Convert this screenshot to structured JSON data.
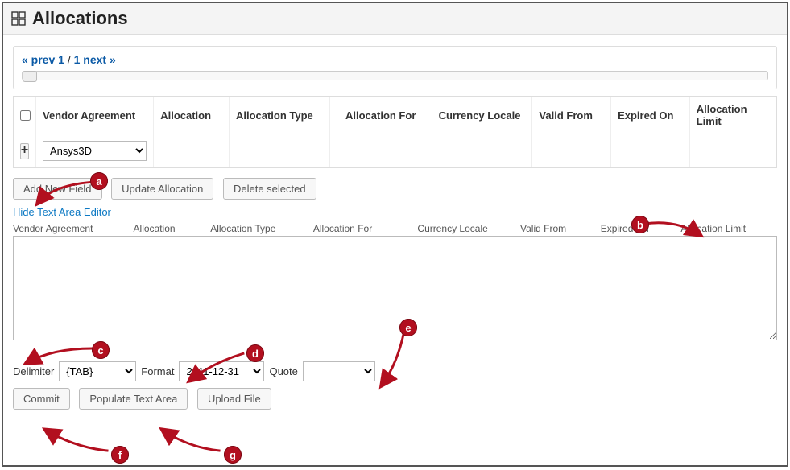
{
  "title": "Allocations",
  "pager": {
    "prev": "« prev",
    "current": "1",
    "sep": "/",
    "total": "1",
    "next": "next »"
  },
  "columns": {
    "vendor": "Vendor Agreement",
    "allocation": "Allocation",
    "type": "Allocation Type",
    "for": "Allocation For",
    "currency": "Currency Locale",
    "from": "Valid From",
    "expired": "Expired On",
    "limit": "Allocation Limit"
  },
  "row": {
    "plus": "+",
    "vendor_selected": "Ansys3D"
  },
  "buttons": {
    "add": "Add New Field",
    "update": "Update Allocation",
    "delete": "Delete selected",
    "commit": "Commit",
    "populate": "Populate Text Area",
    "upload": "Upload File"
  },
  "toggle_link": "Hide Text Area Editor",
  "ta_headers": {
    "vendor": "Vendor Agreement",
    "allocation": "Allocation",
    "type": "Allocation Type",
    "for": "Allocation For",
    "currency": "Currency Locale",
    "from": "Valid From",
    "expired": "Expired On",
    "limit": "Allocation Limit"
  },
  "controls": {
    "delimiter_label": "Delimiter",
    "delimiter_value": "{TAB}",
    "format_label": "Format",
    "format_value": "2011-12-31",
    "quote_label": "Quote",
    "quote_value": ""
  },
  "annotations": {
    "a": "a",
    "b": "b",
    "c": "c",
    "d": "d",
    "e": "e",
    "f": "f",
    "g": "g"
  }
}
